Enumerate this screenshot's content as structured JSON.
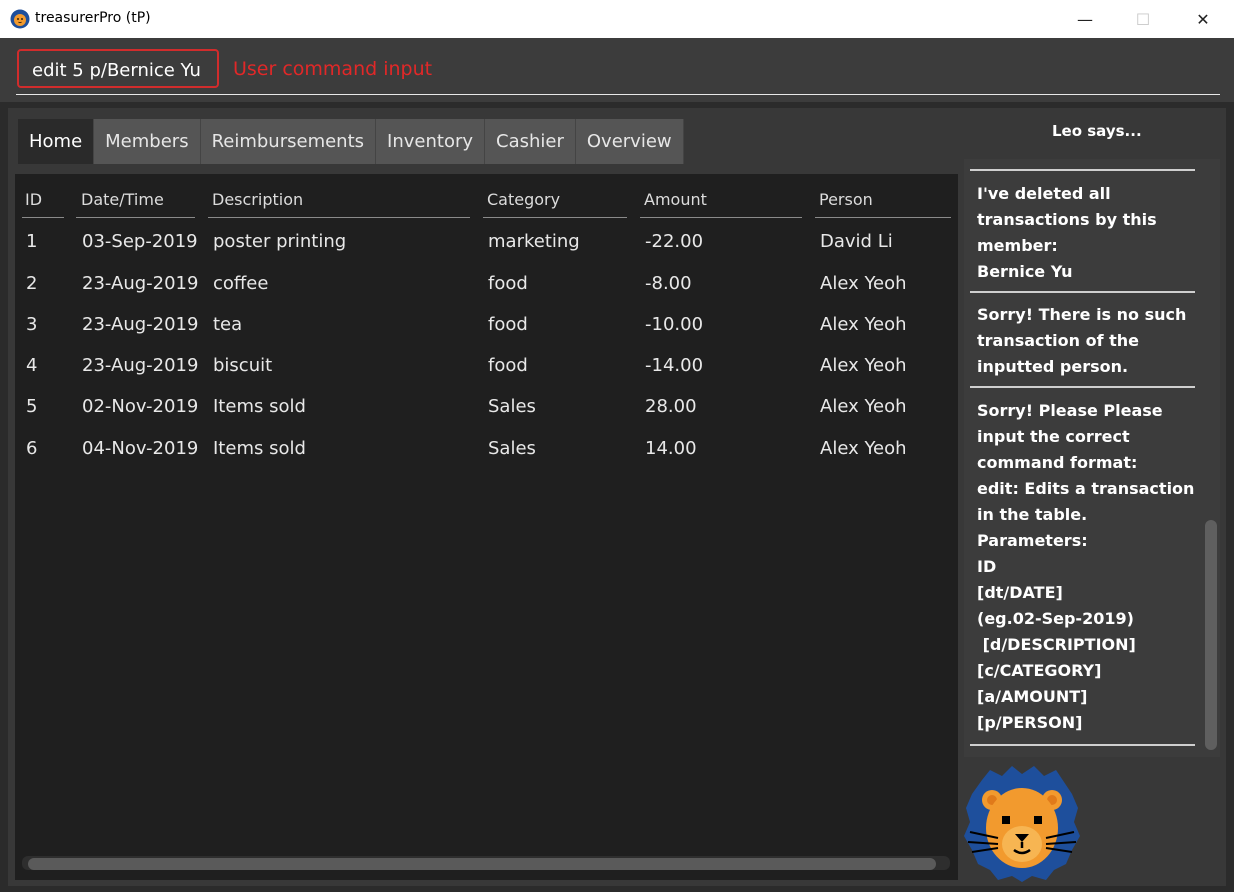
{
  "window": {
    "title": "treasurerPro (tP)",
    "controls": {
      "minimize": "—",
      "maximize": "☐",
      "close": "✕"
    }
  },
  "command": {
    "value": "edit 5 p/Bernice Yu",
    "annotation": "User command input"
  },
  "tabs": [
    {
      "label": "Home",
      "active": true
    },
    {
      "label": "Members",
      "active": false
    },
    {
      "label": "Reimbursements",
      "active": false
    },
    {
      "label": "Inventory",
      "active": false
    },
    {
      "label": "Cashier",
      "active": false
    },
    {
      "label": "Overview",
      "active": false
    }
  ],
  "table": {
    "headers": [
      "ID",
      "Date/Time",
      "Description",
      "Category",
      "Amount",
      "Person"
    ],
    "rows": [
      [
        "1",
        "03-Sep-2019",
        "poster printing",
        "marketing",
        "-22.00",
        "David Li"
      ],
      [
        "2",
        "23-Aug-2019",
        "coffee",
        "food",
        "-8.00",
        "Alex Yeoh"
      ],
      [
        "3",
        "23-Aug-2019",
        "tea",
        "food",
        "-10.00",
        "Alex Yeoh"
      ],
      [
        "4",
        "23-Aug-2019",
        "biscuit",
        "food",
        "-14.00",
        "Alex Yeoh"
      ],
      [
        "5",
        "02-Nov-2019",
        "Items sold",
        "Sales",
        "28.00",
        "Alex Yeoh"
      ],
      [
        "6",
        "04-Nov-2019",
        "Items sold",
        "Sales",
        "14.00",
        "Alex Yeoh"
      ]
    ]
  },
  "leo": {
    "title": "Leo says...",
    "messages": [
      "I've deleted all\ntransactions by this\nmember:\nBernice Yu",
      "Sorry! There is no such\ntransaction of the\ninputted person.",
      "Sorry! Please Please\ninput the correct\ncommand format:\nedit: Edits a transaction\nin the table.\nParameters:\nID\n[dt/DATE]\n(eg.02-Sep-2019)\n [d/DESCRIPTION]\n[c/CATEGORY]\n[a/AMOUNT]\n[p/PERSON]"
    ],
    "avatar_icon": "lion-icon"
  },
  "colors": {
    "accent_red": "#e12828",
    "panel_dark": "#1f1f1f",
    "tab_inactive": "#555555"
  }
}
